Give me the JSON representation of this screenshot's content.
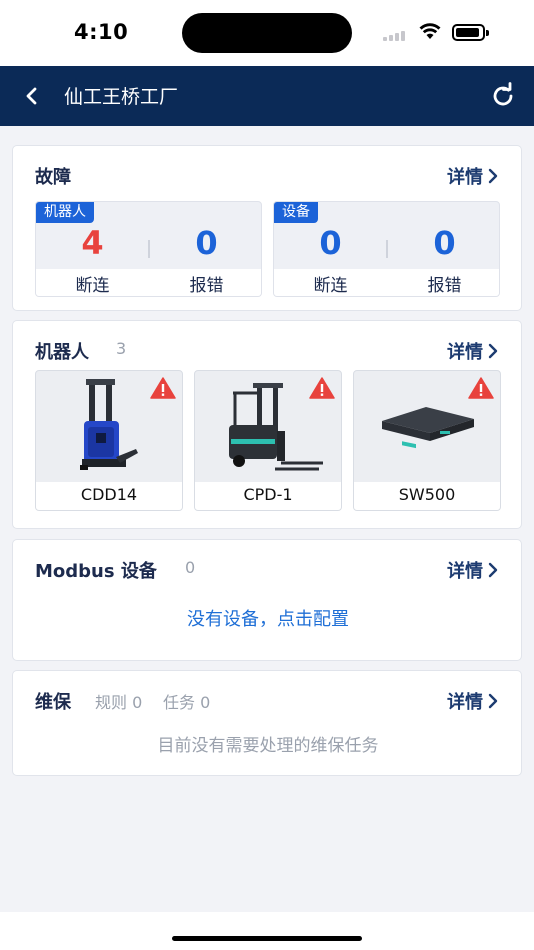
{
  "status_bar": {
    "time": "4:10"
  },
  "nav": {
    "title": "仙工王桥工厂",
    "back_icon": "chevron-left-icon",
    "refresh_icon": "refresh-icon"
  },
  "faults": {
    "title": "故障",
    "detail_label": "详情",
    "robot": {
      "tag": "机器人",
      "disconnected": 4,
      "disconnected_label": "断连",
      "errors": 0,
      "errors_label": "报错"
    },
    "device": {
      "tag": "设备",
      "disconnected": 0,
      "disconnected_label": "断连",
      "errors": 0,
      "errors_label": "报错"
    }
  },
  "robots": {
    "title": "机器人",
    "count": "3",
    "detail_label": "详情",
    "items": [
      {
        "name": "CDD14",
        "warning": true,
        "icon": "warning-icon"
      },
      {
        "name": "CPD-1",
        "warning": true,
        "icon": "warning-icon"
      },
      {
        "name": "SW500",
        "warning": true,
        "icon": "warning-icon"
      }
    ]
  },
  "modbus": {
    "title": "Modbus 设备",
    "count": "0",
    "detail_label": "详情",
    "empty_action": "没有设备，点击配置"
  },
  "maintenance": {
    "title": "维保",
    "rules_text": "规则 0",
    "tasks_text": "任务 0",
    "detail_label": "详情",
    "empty_text": "目前没有需要处理的维保任务"
  },
  "colors": {
    "nav_bg": "#0b2a57",
    "accent_blue": "#1c63d8",
    "alert_red": "#e8423d",
    "link_blue": "#1f6fd6"
  }
}
